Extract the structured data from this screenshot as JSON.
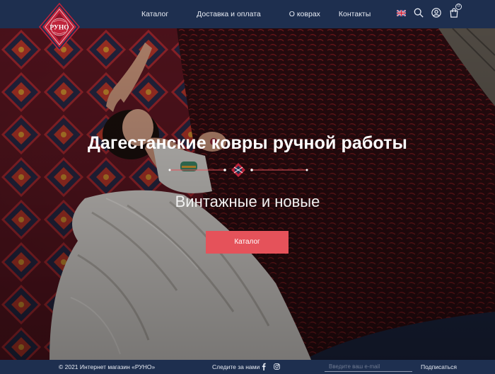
{
  "logo": {
    "text": "РУНО",
    "arc_text": "ковры ручной работы"
  },
  "nav": {
    "items": [
      "Каталог",
      "Доставка и оплата",
      "О коврах",
      "Контакты"
    ]
  },
  "header": {
    "cart_count": "0"
  },
  "hero": {
    "title": "Дагестанские ковры ручной работы",
    "subtitle": "Винтажные и новые",
    "button_label": "Каталог"
  },
  "footer": {
    "copyright": "© 2021 Интернет магазин «РУНО»",
    "follow_label": "Следите за нами",
    "email_placeholder": "Введите ваш e-mail",
    "subscribe_label": "Подписаться"
  },
  "colors": {
    "header_bg": "#1e2f4f",
    "accent": "#e5525a",
    "logo_red": "#c0243b"
  }
}
